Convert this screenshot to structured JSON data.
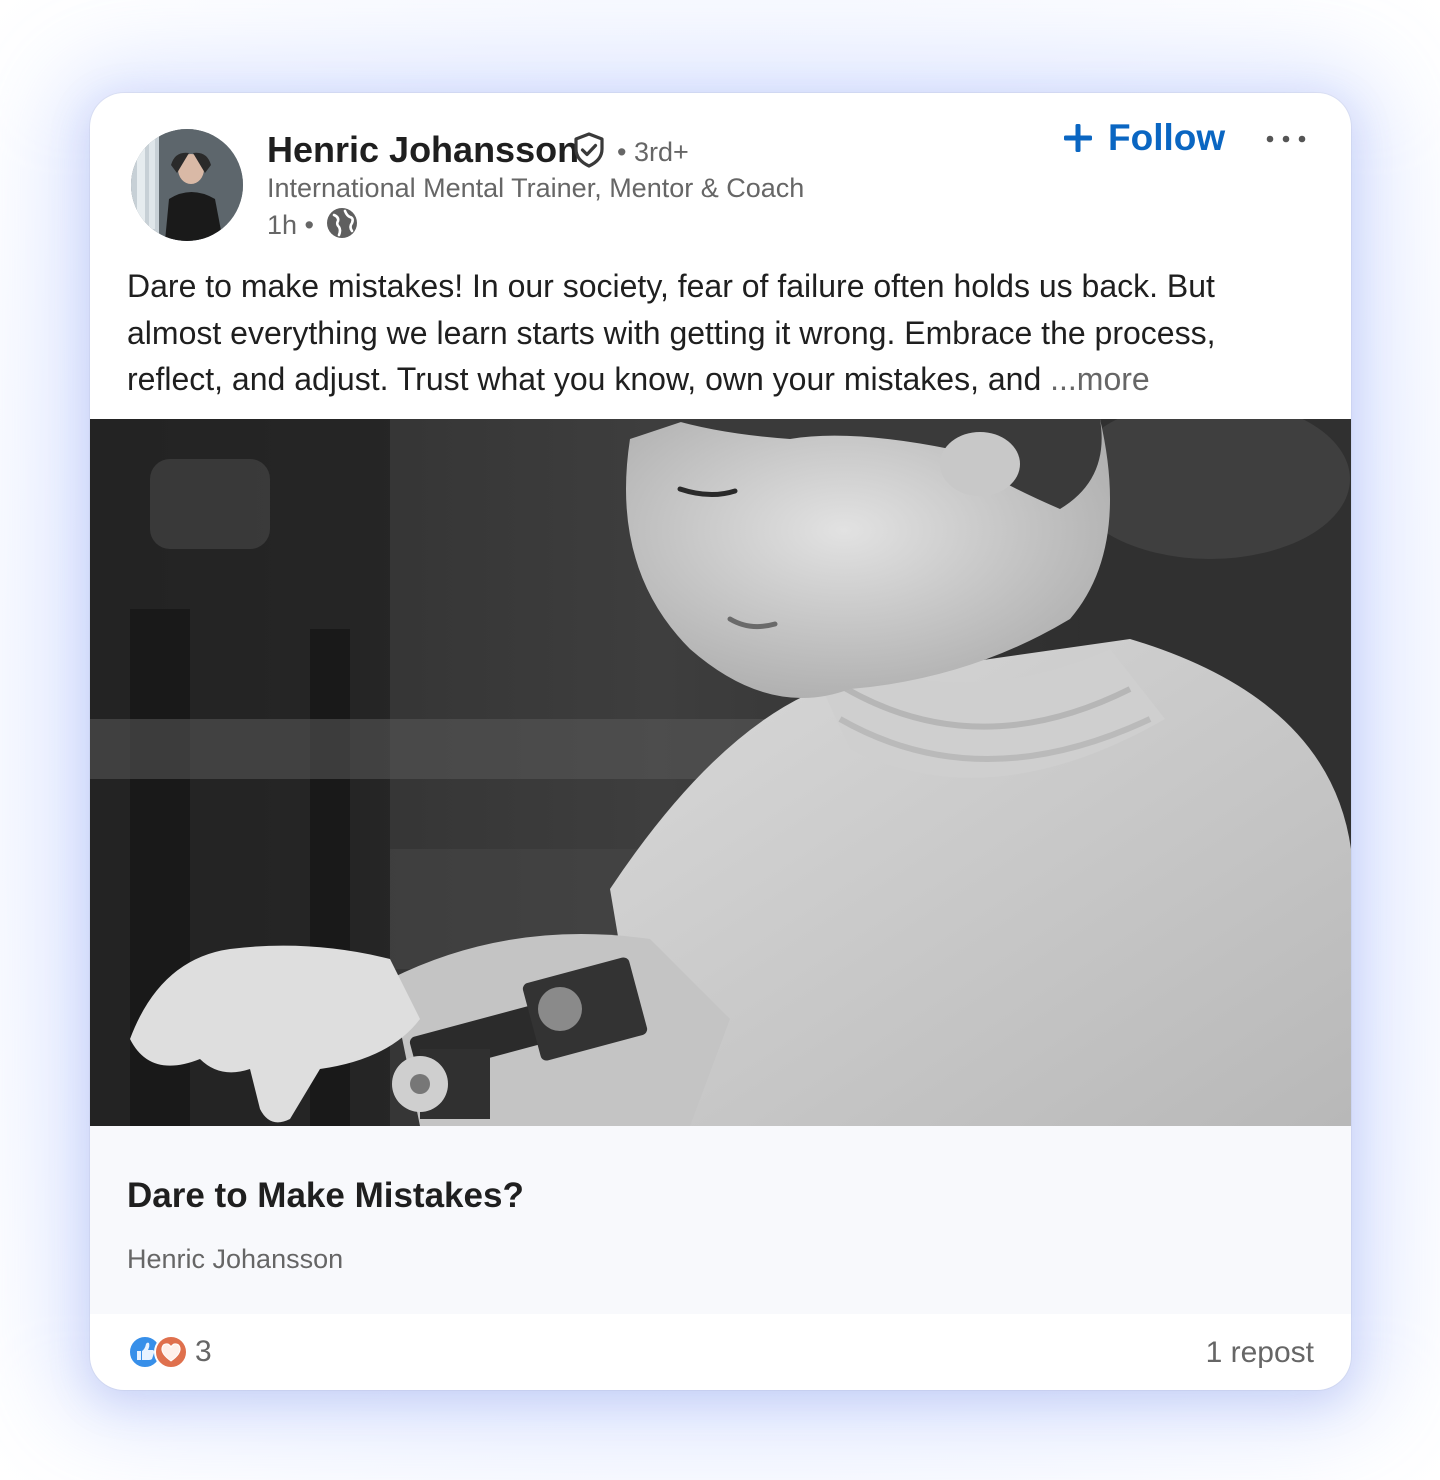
{
  "post": {
    "author": {
      "name": "Henric Johansson",
      "degree": "• 3rd+",
      "headline": "International Mental Trainer, Mentor & Coach",
      "time": "1h •",
      "verified_icon": "verified-shield-icon",
      "visibility_icon": "globe-icon"
    },
    "actions": {
      "follow_label": "Follow",
      "follow_icon": "plus-icon",
      "more_icon": "ellipsis-icon"
    },
    "text": "Dare to make mistakes! In our society, fear of failure often holds us back. But almost everything we learn starts with getting it wrong. Embrace the process, reflect, and adjust. Trust what you know, own your mistakes, and ",
    "see_more": "...more",
    "image_description_icon": "photo-child-building-blocks",
    "article": {
      "title": "Dare to Make Mistakes?",
      "author": "Henric Johansson"
    },
    "social": {
      "reaction_icons": [
        "like-icon",
        "love-icon"
      ],
      "reaction_count": "3",
      "reposts": "1 repost"
    }
  },
  "colors": {
    "accent": "#0a66c2",
    "like": "#378fe9",
    "love": "#df704d",
    "muted_text": "#666666"
  }
}
